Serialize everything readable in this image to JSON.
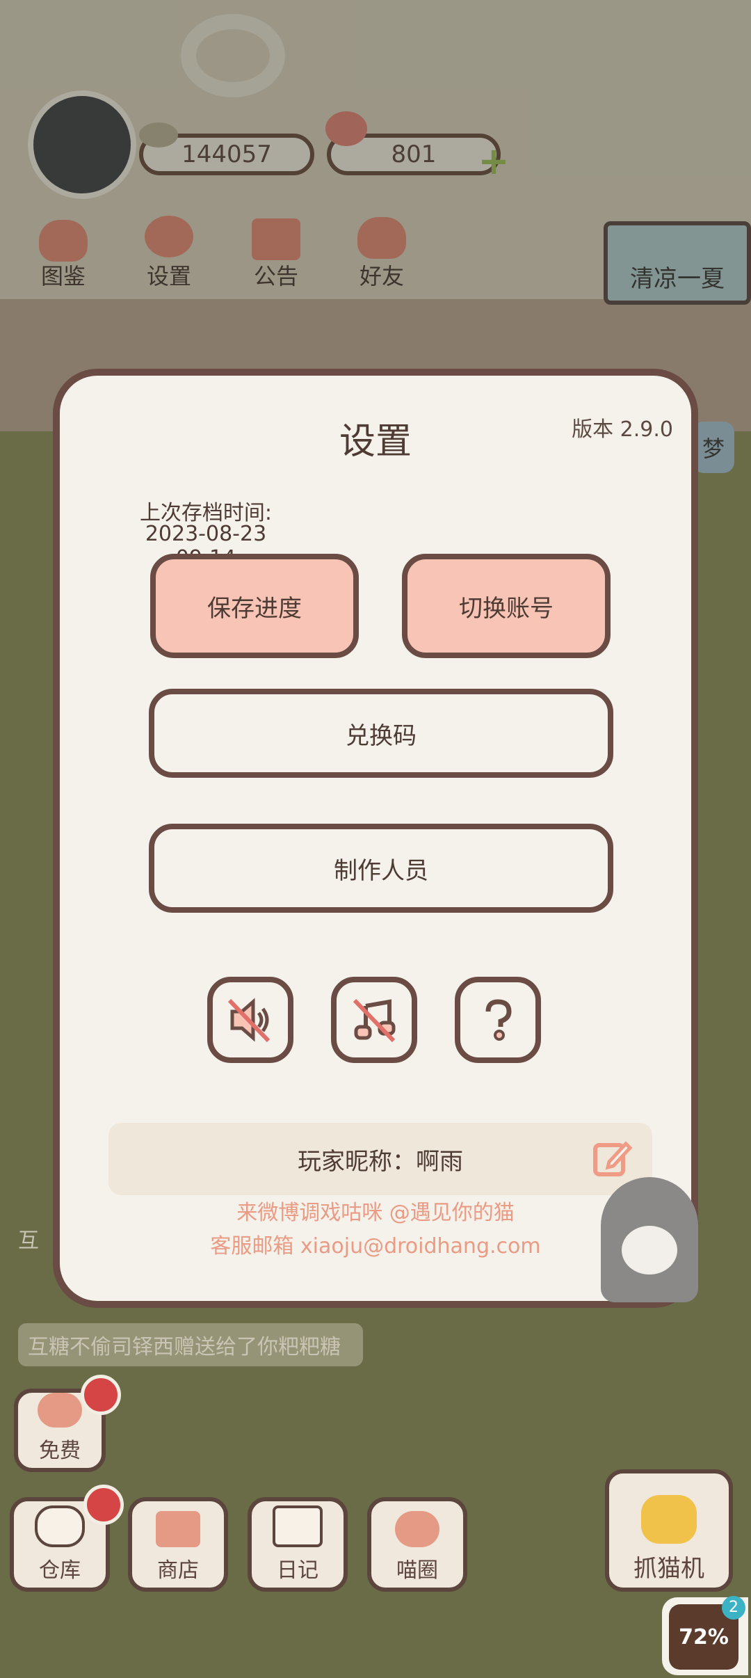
{
  "hud": {
    "fish_count": "144057",
    "heart_count": "801",
    "menu": [
      {
        "label": "图鉴",
        "icon": "cat-book-icon"
      },
      {
        "label": "设置",
        "icon": "gear-icon"
      },
      {
        "label": "公告",
        "icon": "gift-icon"
      },
      {
        "label": "好友",
        "icon": "friends-icon"
      }
    ],
    "event_banner": "清凉一夏",
    "side_badge": "梦"
  },
  "dialog": {
    "title": "设置",
    "version": "版本 2.9.0",
    "last_save_label": "上次存档时间:",
    "last_save_time": "2023-08-23 09:14",
    "save_button": "保存进度",
    "switch_account_button": "切换账号",
    "redeem_code_button": "兑换码",
    "credits_button": "制作人员",
    "icon_buttons": [
      "sound-muted-icon",
      "music-muted-icon",
      "help-icon"
    ],
    "nickname_label": "玩家昵称：啊雨",
    "footer_weibo": "来微博调戏咕咪 @遇见你的猫",
    "footer_email": "客服邮箱 xiaoju@droidhang.com"
  },
  "background": {
    "toast_text": "互糖不偷司铎西赠送给了你粑粑糖",
    "toast_text_partial": "互"
  },
  "bottom_bar": {
    "free": "免费",
    "items": [
      "仓库",
      "商店",
      "日记",
      "喵圈"
    ],
    "claw_machine": "抓猫机"
  },
  "floating_badge": {
    "count": "2",
    "percent": "72%"
  },
  "colors": {
    "pink_button": "#f8c4b5",
    "border_brown": "#6a4c45",
    "footer_text": "#ea9b84",
    "dialog_bg": "#f5f2ec"
  }
}
